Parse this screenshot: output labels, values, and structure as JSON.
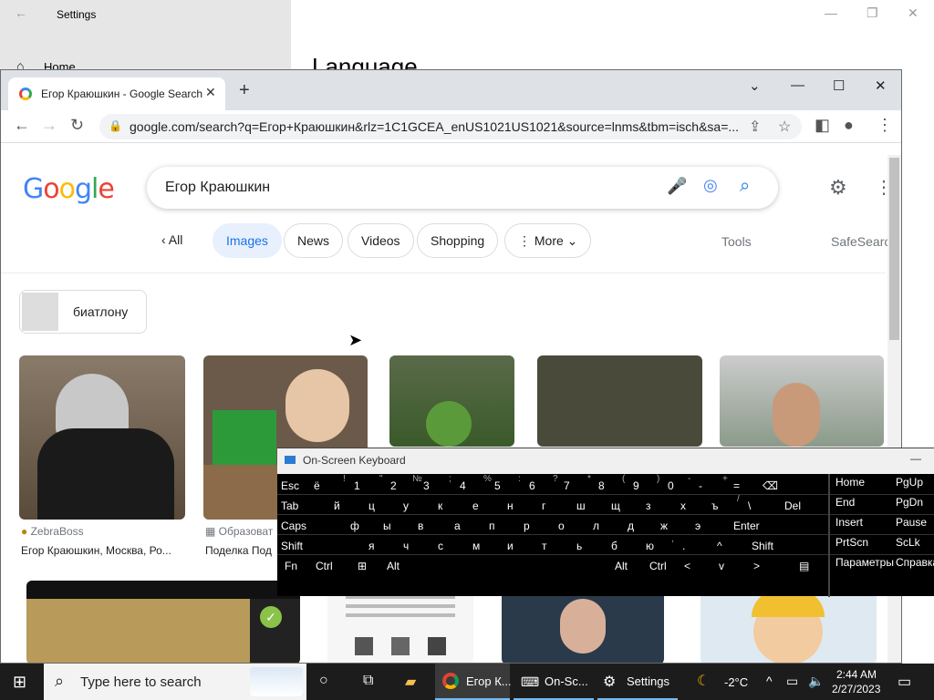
{
  "settings": {
    "title": "Settings",
    "home": "Home",
    "heading": "Language"
  },
  "chrome": {
    "tab_title": "Егор Краюшкин - Google Search",
    "url": "google.com/search?q=Егор+Краюшкин&rlz=1C1GCEA_enUS1021US1021&source=lnms&tbm=isch&sa=..."
  },
  "google": {
    "logo": [
      "G",
      "o",
      "o",
      "g",
      "l",
      "e"
    ],
    "logo_colors": [
      "#4285f4",
      "#ea4335",
      "#fbbc05",
      "#4285f4",
      "#34a853",
      "#ea4335"
    ],
    "query": "Егор Краюшкин",
    "nav": {
      "all": "All",
      "images": "Images",
      "news": "News",
      "videos": "Videos",
      "shopping": "Shopping",
      "more": "More",
      "tools": "Tools",
      "safesearch": "SafeSearch"
    },
    "related_chip": "биатлону",
    "results": [
      {
        "source": "ZebraBoss",
        "caption": "Егор Краюшкин, Москва, Ро..."
      },
      {
        "source": "Образоват",
        "caption": "Поделка Под"
      }
    ]
  },
  "osk": {
    "title": "On-Screen Keyboard",
    "rows": [
      [
        {
          "k": "Esc"
        },
        {
          "k": "ё"
        },
        {
          "k": "1",
          "s": "!"
        },
        {
          "k": "2",
          "s": "\""
        },
        {
          "k": "3",
          "s": "№"
        },
        {
          "k": "4",
          "s": ";"
        },
        {
          "k": "5",
          "s": "%"
        },
        {
          "k": "6",
          "s": ":"
        },
        {
          "k": "7",
          "s": "?"
        },
        {
          "k": "8",
          "s": "*"
        },
        {
          "k": "9",
          "s": "("
        },
        {
          "k": "0",
          "s": ")"
        },
        {
          "k": "-",
          "s": "-"
        },
        {
          "k": "=",
          "s": "+"
        },
        {
          "k": "⌫"
        }
      ],
      [
        {
          "k": "Tab"
        },
        {
          "k": "й"
        },
        {
          "k": "ц"
        },
        {
          "k": "у"
        },
        {
          "k": "к"
        },
        {
          "k": "е"
        },
        {
          "k": "н"
        },
        {
          "k": "г"
        },
        {
          "k": "ш"
        },
        {
          "k": "щ"
        },
        {
          "k": "з"
        },
        {
          "k": "х"
        },
        {
          "k": "ъ"
        },
        {
          "k": "\\",
          "s": "/"
        },
        {
          "k": "Del"
        }
      ],
      [
        {
          "k": "Caps"
        },
        {
          "k": "ф"
        },
        {
          "k": "ы"
        },
        {
          "k": "в"
        },
        {
          "k": "а"
        },
        {
          "k": "п"
        },
        {
          "k": "р"
        },
        {
          "k": "о"
        },
        {
          "k": "л"
        },
        {
          "k": "д"
        },
        {
          "k": "ж"
        },
        {
          "k": "э"
        },
        {
          "k": "Enter"
        }
      ],
      [
        {
          "k": "Shift"
        },
        {
          "k": "я"
        },
        {
          "k": "ч"
        },
        {
          "k": "с"
        },
        {
          "k": "м"
        },
        {
          "k": "и"
        },
        {
          "k": "т"
        },
        {
          "k": "ь"
        },
        {
          "k": "б"
        },
        {
          "k": "ю"
        },
        {
          "k": ".",
          "s": ","
        },
        {
          "k": "^"
        },
        {
          "k": "Shift"
        }
      ],
      [
        {
          "k": "Fn"
        },
        {
          "k": "Ctrl"
        },
        {
          "k": "⊞"
        },
        {
          "k": "Alt"
        },
        {
          "k": ""
        },
        {
          "k": "Alt"
        },
        {
          "k": "Ctrl"
        },
        {
          "k": "<"
        },
        {
          "k": "v"
        },
        {
          "k": ">"
        },
        {
          "k": "▤"
        }
      ]
    ],
    "side": [
      [
        "Home",
        "PgUp"
      ],
      [
        "End",
        "PgDn"
      ],
      [
        "Insert",
        "Pause"
      ],
      [
        "PrtScn",
        "ScLk"
      ],
      [
        "Параметры",
        "Справка"
      ]
    ]
  },
  "taskbar": {
    "search": "Type here to search",
    "apps": [
      {
        "label": "Егор К..."
      },
      {
        "label": "On-Sc..."
      },
      {
        "label": "Settings"
      }
    ],
    "weather": "-2°C",
    "time": "2:44 AM",
    "date": "2/27/2023"
  }
}
